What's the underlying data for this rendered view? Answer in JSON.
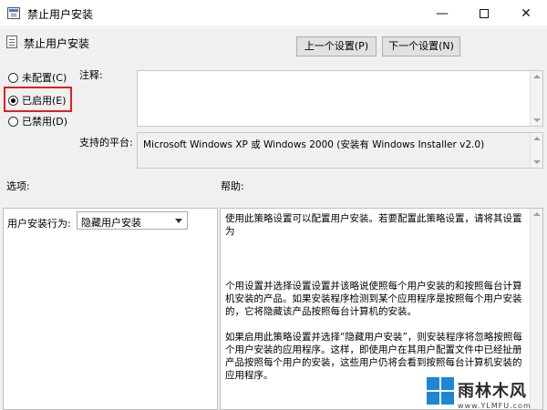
{
  "window": {
    "title": "禁止用户安装",
    "minimize_glyph": "—",
    "close_glyph": "✕"
  },
  "header": {
    "policy_name": "禁止用户安装",
    "prev_button": "上一个设置(P)",
    "next_button": "下一个设置(N)"
  },
  "state": {
    "options": [
      {
        "label": "未配置(C)",
        "checked": false
      },
      {
        "label": "已启用(E)",
        "checked": true
      },
      {
        "label": "已禁用(D)",
        "checked": false
      }
    ],
    "highlight_color": "#e02020"
  },
  "comment": {
    "label": "注释:",
    "value": ""
  },
  "platform": {
    "label": "支持的平台:",
    "value": "Microsoft Windows XP 或 Windows 2000 (安装有 Windows Installer v2.0)"
  },
  "options_section": {
    "label": "选项:",
    "field_label": "用户安装行为:",
    "selected_value": "隐藏用户安装"
  },
  "help_section": {
    "label": "帮助:",
    "paragraphs": [
      "使用此策略设置可以配置用户安装。若要配置此策略设置，请将其设置为",
      "个用设置并选择设置设置并该略说使照每个用户安装的和按照每台计算机安装的产品。如果安装程序检测到某个应用程序是按照每个用户安装的，它将隐藏该产品按照每台计算机的安装。",
      "如果启用此策略设置并选择“隐藏用户安装”，则安装程序将忽略按照每个用户安装的应用程序。这样，即使用户在其用户配置文件中已经扯册产品按照每个用户的安装，这些用户仍将会看到按照每台计算机安装的应用程序。"
    ]
  },
  "watermark": {
    "name": "雨林木风",
    "url": "www.YLMFU.com",
    "logo_color": "#1e86d6"
  }
}
